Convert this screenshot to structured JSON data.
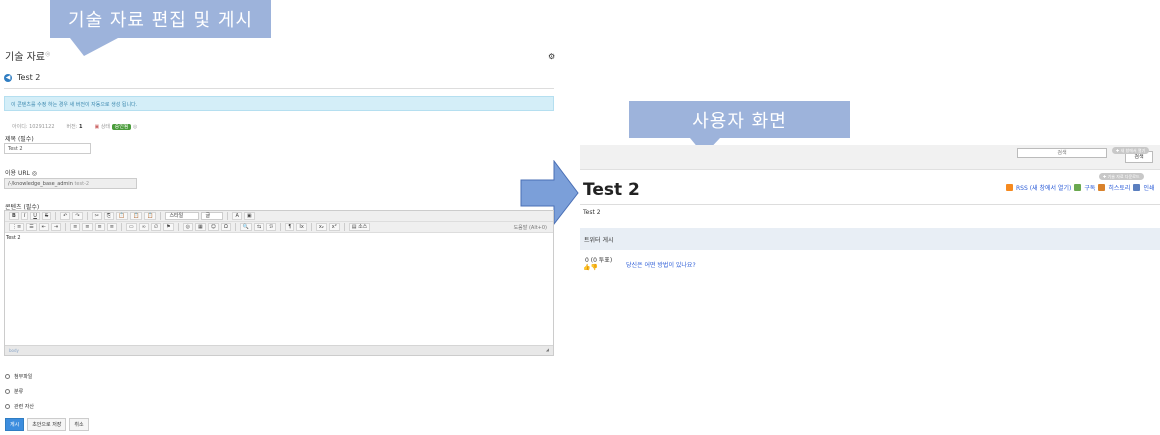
{
  "callouts": {
    "left": "기술 자료 편집 및 게시",
    "right": "사용자 화면"
  },
  "editor_page": {
    "title": "기술 자료",
    "back_title": "Test 2",
    "info_message": "이 콘텐츠를 수정 하는 경우 새 버전이 자동으로 생성 됩니다.",
    "meta": {
      "id_label": "아이디: 10291122",
      "version_label": "버전:",
      "version_value": "1",
      "status_label": "상태",
      "status_badge": "승인됨"
    },
    "title_field": {
      "label": "제목 (필수)",
      "value": "Test 2"
    },
    "url_field": {
      "label": "이용 URL",
      "prefix": "/-/knowledge_base_admin",
      "value": "test-2"
    },
    "content_field": {
      "label": "콘텐츠 (필수)"
    },
    "toolbar": {
      "row1": [
        "B",
        "I",
        "U",
        "S",
        "↶",
        "↷",
        "✂",
        "⎘",
        "📋",
        "📋",
        "📋"
      ],
      "style_select": "스타일",
      "format_select": "글",
      "font_color": "A",
      "row2": [
        "⋮≡",
        "☰",
        "⇤",
        "⇥",
        "≡",
        "≡",
        "≡",
        "≡",
        "▭",
        "∞",
        "∅",
        "⚑",
        "◎",
        "▦",
        "☺",
        "Ω",
        "🔍",
        "⇆",
        "ℬ",
        "¶",
        "Ix",
        "x₂",
        "x²"
      ],
      "source_label": "소스",
      "right_hint": "도움말 (Alt+0)"
    },
    "editor_content": "Test 2",
    "editor_footer": "body",
    "collapsibles": [
      "첨부파일",
      "분류",
      "관련 자산"
    ],
    "buttons": {
      "publish": "게시",
      "save_draft": "초안으로 저장",
      "cancel": "취소"
    }
  },
  "user_page": {
    "search_placeholder": "검색",
    "search_button": "검색",
    "pill_top": "새 창에서 열기",
    "pill_bottom": "기술 자료 다운로드",
    "title": "Test 2",
    "actions": {
      "rss": "RSS (새 창에서 열기)",
      "subscribe": "구독",
      "history": "히스토리",
      "print": "인쇄"
    },
    "body": "Test 2",
    "twitter_label": "트위터 게시",
    "rating": "0 (0 투표)",
    "helpful_question": "당신은 어떤 방법이 있나요?"
  },
  "colors": {
    "callout": "#9db3db",
    "arrow_fill": "#7b9fd9",
    "link": "#2a5bd7",
    "primary_button": "#3c8dde"
  }
}
